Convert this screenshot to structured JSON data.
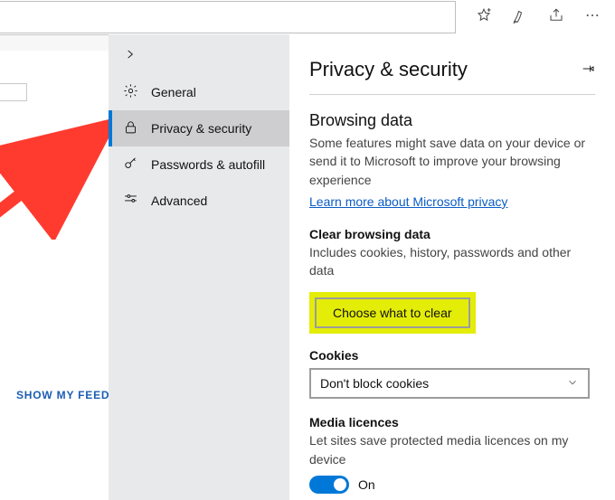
{
  "show_my_feed": "SHOW MY FEED",
  "nav": {
    "general": "General",
    "privacy": "Privacy & security",
    "passwords": "Passwords & autofill",
    "advanced": "Advanced"
  },
  "main": {
    "title": "Privacy & security",
    "browsing_data_heading": "Browsing data",
    "browsing_data_body": "Some features might save data on your device or send it to Microsoft to improve your browsing experience",
    "learn_more": "Learn more about Microsoft privacy",
    "clear_heading": "Clear browsing data",
    "clear_body": "Includes cookies, history, passwords and other data",
    "choose_button": "Choose what to clear",
    "cookies_heading": "Cookies",
    "cookies_value": "Don't block cookies",
    "media_heading": "Media licences",
    "media_body": "Let sites save protected media licences on my device",
    "toggle_label": "On"
  }
}
